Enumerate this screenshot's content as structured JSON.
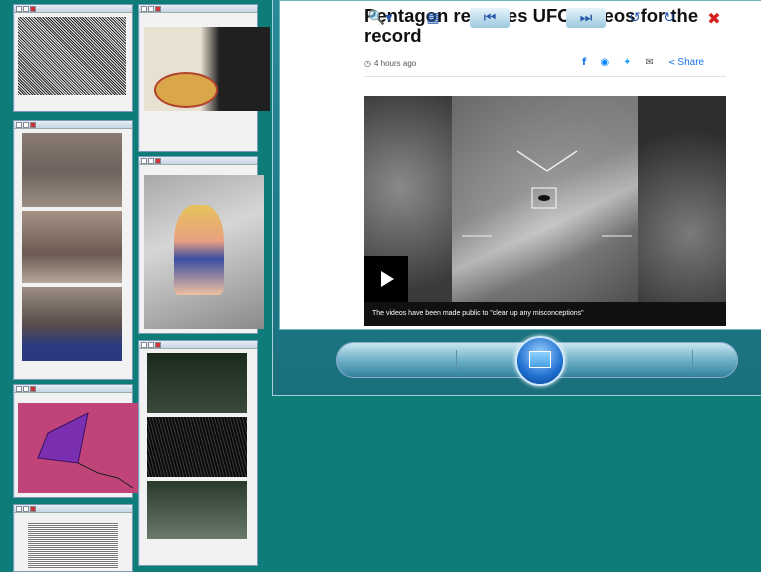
{
  "article": {
    "headline": "Pentagon releases UFO videos for the record",
    "timestamp": "4 hours ago",
    "share_label": "Share",
    "video_caption": "The videos have been made public to \"clear up any misconceptions\""
  },
  "viewer_controls": {
    "icons": [
      "zoom-icon",
      "slideshow-icon",
      "previous-icon",
      "display-icon",
      "next-icon",
      "rotate-left-icon",
      "rotate-right-icon",
      "delete-icon"
    ]
  },
  "colors": {
    "desktop": "#0e7d7a",
    "delete": "#d42020",
    "link": "#1a73e8"
  }
}
